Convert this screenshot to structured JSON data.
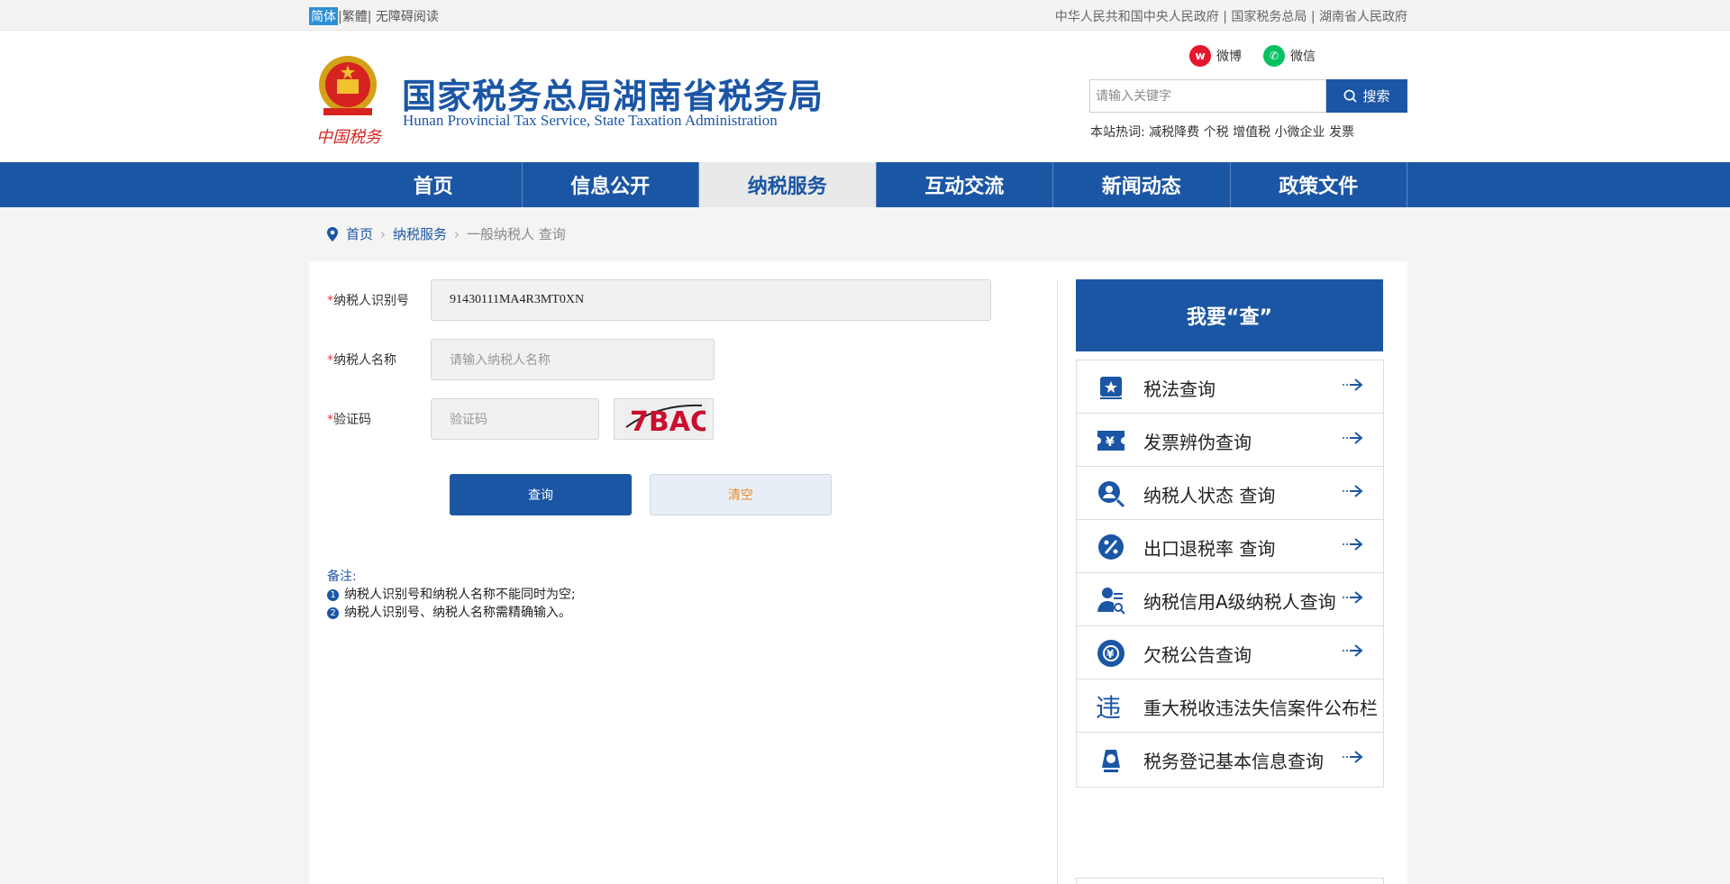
{
  "topbar": {
    "lang_simplified": "简体",
    "lang_traditional": "繁體",
    "accessibility": "无障碍阅读",
    "links": "中华人民共和国中央人民政府 | 国家税务总局 | 湖南省人民政府"
  },
  "header": {
    "emblem_text": "中国税务",
    "title": "国家税务总局湖南省税务局",
    "subtitle": "Hunan Provincial  Tax Service,  State Taxation Administration",
    "weibo": "微博",
    "wechat": "微信",
    "search_placeholder": "请输入关键字",
    "search_button": "搜索",
    "hotwords": "本站热词: 减税降费 个税 增值税 小微企业 发票"
  },
  "nav": {
    "items": [
      "首页",
      "信息公开",
      "纳税服务",
      "互动交流",
      "新闻动态",
      "政策文件"
    ],
    "active_index": 2
  },
  "breadcrumb": {
    "home": "首页",
    "section": "纳税服务",
    "current": "一般纳税人 查询"
  },
  "form": {
    "taxpayer_id_label": "纳税人识别号",
    "taxpayer_id_value": "91430111MA4R3MT0XN",
    "taxpayer_name_label": "纳税人名称",
    "taxpayer_name_placeholder": "请输入纳税人名称",
    "captcha_label": "验证码",
    "captcha_placeholder": "验证码",
    "captcha_text": "7BAC",
    "required_mark": "*",
    "query_button": "查询",
    "clear_button": "清空"
  },
  "notes": {
    "title": "备注:",
    "items": [
      "纳税人识别号和纳税人名称不能同时为空;",
      "纳税人识别号、纳税人名称需精确输入。"
    ]
  },
  "sidebar": {
    "heading": "我要“查”",
    "items": [
      {
        "label": "税法查询",
        "icon": "law-book-icon"
      },
      {
        "label": "发票辨伪查询",
        "icon": "invoice-ticket-icon"
      },
      {
        "label": "纳税人状态 查询",
        "icon": "taxpayer-search-icon"
      },
      {
        "label": "出口退税率 查询",
        "icon": "percent-icon"
      },
      {
        "label": "纳税信用A级纳税人查询",
        "icon": "credit-person-icon"
      },
      {
        "label": "欠税公告查询",
        "icon": "yuan-coin-icon"
      },
      {
        "label": "重大税收违法失信案件公布栏",
        "icon": "violation-icon"
      },
      {
        "label": "税务登记基本信息查询",
        "icon": "registration-icon"
      }
    ]
  },
  "colors": {
    "brand_blue": "#1b56a5",
    "required_red": "#e4393c",
    "clear_orange": "#f08a24"
  }
}
